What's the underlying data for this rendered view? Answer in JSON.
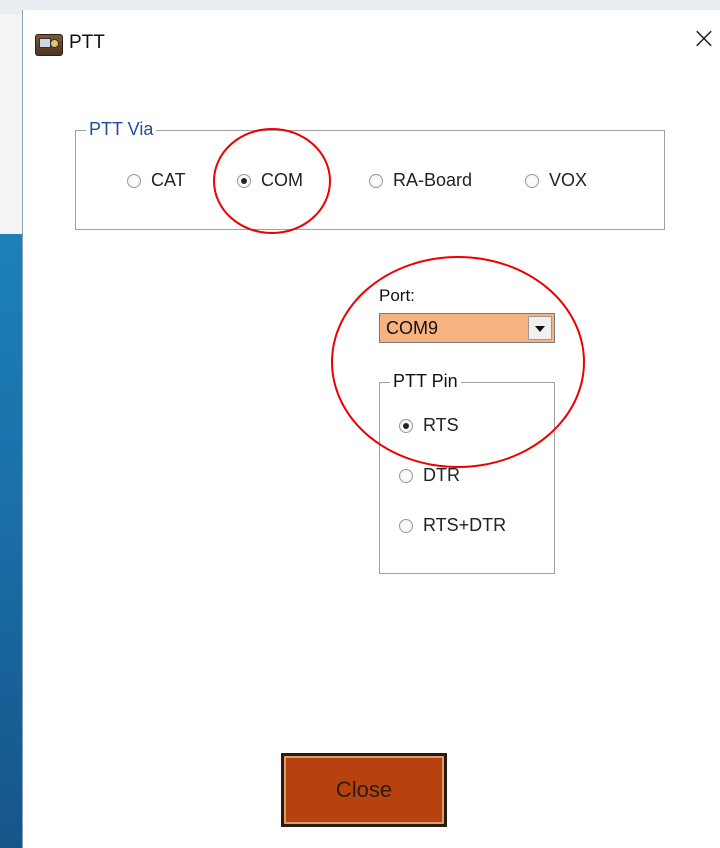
{
  "window": {
    "title": "PTT",
    "close_glyph": "×"
  },
  "ptt_via": {
    "legend": "PTT Via",
    "options": [
      {
        "label": "CAT",
        "checked": false
      },
      {
        "label": "COM",
        "checked": true
      },
      {
        "label": "RA-Board",
        "checked": false
      },
      {
        "label": "VOX",
        "checked": false
      }
    ]
  },
  "port": {
    "label": "Port:",
    "value": "COM9"
  },
  "ptt_pin": {
    "legend": "PTT Pin",
    "options": [
      {
        "label": "RTS",
        "checked": true
      },
      {
        "label": "DTR",
        "checked": false
      },
      {
        "label": "RTS+DTR",
        "checked": false
      }
    ]
  },
  "footer": {
    "close_label": "Close"
  },
  "colors": {
    "legend_text": "#1f4e9c",
    "combo_bg": "#f6b280",
    "close_button": "#b8420f",
    "annotation_red": "#e00000"
  },
  "icons": {
    "app": "radio-transceiver-icon",
    "close": "close-icon"
  }
}
